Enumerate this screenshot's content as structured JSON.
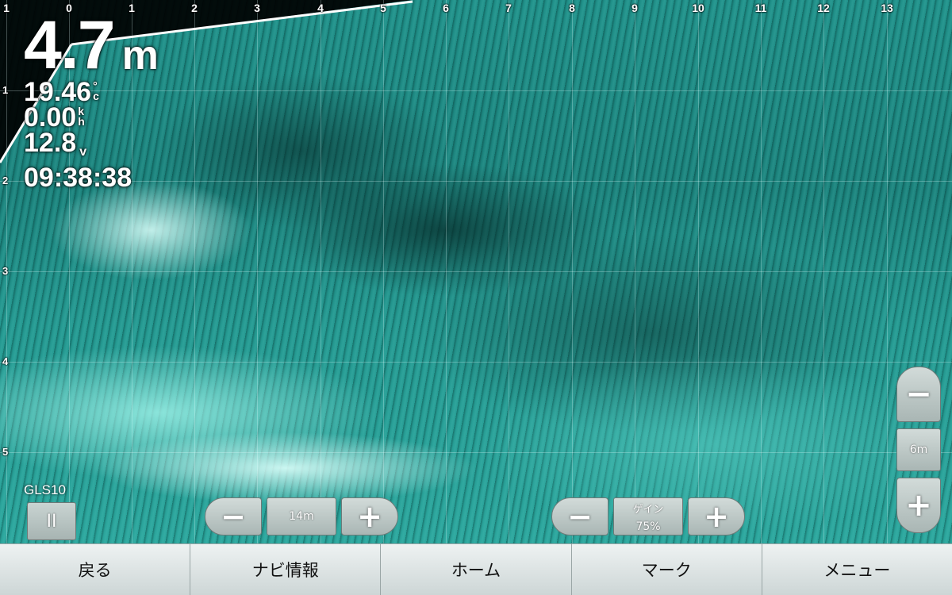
{
  "readout": {
    "depth_value": "4.7",
    "depth_unit": "m",
    "temperature": "19.46",
    "temperature_unit_top": "°",
    "temperature_unit_bottom": "c",
    "speed": "0.00",
    "speed_unit_top": "k",
    "speed_unit_bottom": "h",
    "voltage": "12.8",
    "voltage_unit": "v",
    "time": "09:38:38"
  },
  "horizontal_scale": [
    "1",
    "0",
    "1",
    "2",
    "3",
    "4",
    "5",
    "6",
    "7",
    "8",
    "9",
    "10",
    "11",
    "12",
    "13"
  ],
  "vertical_scale": [
    "1",
    "2",
    "3",
    "4",
    "5"
  ],
  "source": {
    "label": "GLS10",
    "pause_icon": "pause-icon",
    "pause_glyph": "II"
  },
  "range_control": {
    "minus": "−",
    "value": "14m",
    "plus": "+"
  },
  "gain_control": {
    "minus": "−",
    "caption": "ゲイン",
    "value": "75%",
    "plus": "+"
  },
  "zoom_control": {
    "minus": "−",
    "value": "6m",
    "plus": "+"
  },
  "bottom_bar": {
    "items": [
      {
        "label": "戻る"
      },
      {
        "label": "ナビ情報"
      },
      {
        "label": "ホーム"
      },
      {
        "label": "マーク"
      },
      {
        "label": "メニュー"
      }
    ]
  },
  "colors": {
    "sonar_base": "#1f8f88",
    "sonar_bright": "#dcfffa",
    "button": "#b8c4c2",
    "bar": "#dfe6e6"
  }
}
